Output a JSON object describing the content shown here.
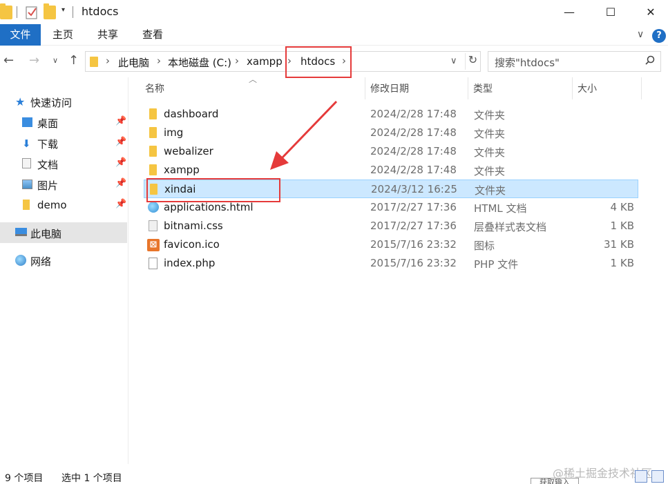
{
  "window": {
    "title": "htdocs",
    "minimize": "—",
    "maximize": "☐",
    "close": "✕"
  },
  "ribbon": {
    "tabs": [
      "文件",
      "主页",
      "共享",
      "查看"
    ],
    "expand": "∨",
    "help": "?"
  },
  "address": {
    "crumbs": [
      "此电脑",
      "本地磁盘 (C:)",
      "xampp",
      "htdocs"
    ],
    "separator": "›"
  },
  "search": {
    "placeholder": "搜索\"htdocs\""
  },
  "sidebar": {
    "quick_access": "快速访问",
    "items": [
      {
        "label": "桌面",
        "pinned": true
      },
      {
        "label": "下载",
        "pinned": true
      },
      {
        "label": "文档",
        "pinned": true
      },
      {
        "label": "图片",
        "pinned": true
      },
      {
        "label": "demo",
        "pinned": true
      }
    ],
    "this_pc": "此电脑",
    "network": "网络"
  },
  "columns": {
    "name": "名称",
    "date": "修改日期",
    "type": "类型",
    "size": "大小"
  },
  "files": [
    {
      "name": "dashboard",
      "date": "2024/2/28 17:48",
      "type": "文件夹",
      "size": "",
      "icon": "folder-icon"
    },
    {
      "name": "img",
      "date": "2024/2/28 17:48",
      "type": "文件夹",
      "size": "",
      "icon": "folder-icon"
    },
    {
      "name": "webalizer",
      "date": "2024/2/28 17:48",
      "type": "文件夹",
      "size": "",
      "icon": "folder-icon"
    },
    {
      "name": "xampp",
      "date": "2024/2/28 17:48",
      "type": "文件夹",
      "size": "",
      "icon": "folder-icon"
    },
    {
      "name": "xindai",
      "date": "2024/3/12 16:25",
      "type": "文件夹",
      "size": "",
      "icon": "folder-icon",
      "selected": true
    },
    {
      "name": "applications.html",
      "date": "2017/2/27 17:36",
      "type": "HTML 文档",
      "size": "4 KB",
      "icon": "html-file-icon"
    },
    {
      "name": "bitnami.css",
      "date": "2017/2/27 17:36",
      "type": "层叠样式表文档",
      "size": "1 KB",
      "icon": "css-file-icon"
    },
    {
      "name": "favicon.ico",
      "date": "2015/7/16 23:32",
      "type": "图标",
      "size": "31 KB",
      "icon": "xampp-ico-icon"
    },
    {
      "name": "index.php",
      "date": "2015/7/16 23:32",
      "type": "PHP 文件",
      "size": "1 KB",
      "icon": "php-file-icon"
    }
  ],
  "status": {
    "count": "9 个项目",
    "selected": "选中 1 个项目"
  },
  "watermark": "@稀土掘金技术社区",
  "partial_button": "获取输入",
  "colors": {
    "file_tab": "#1f6fc5",
    "selection": "#cce8ff",
    "annotation": "#e53a3a",
    "folder": "#f5c542"
  }
}
